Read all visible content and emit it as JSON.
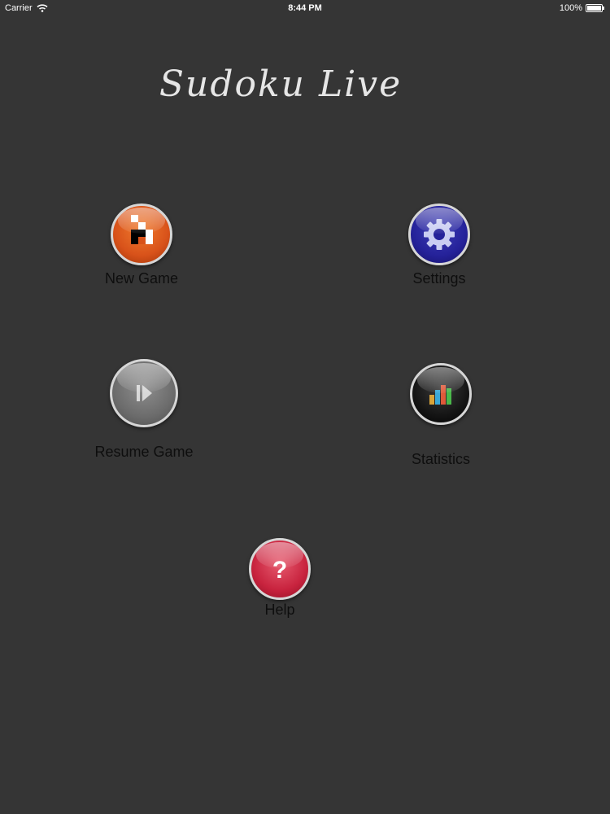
{
  "status_bar": {
    "carrier": "Carrier",
    "time": "8:44 PM",
    "battery": "100%"
  },
  "app": {
    "title": "Sudoku Live"
  },
  "menu": {
    "new_game": {
      "label": "New Game",
      "icon": "grid-blocks-icon",
      "color": "#d8521a"
    },
    "settings": {
      "label": "Settings",
      "icon": "gear-icon",
      "color": "#25229a"
    },
    "resume_game": {
      "label": "Resume Game",
      "icon": "play-pause-icon",
      "color": "#6c6c6c"
    },
    "statistics": {
      "label": "Statistics",
      "icon": "bar-chart-icon",
      "color": "#151515"
    },
    "help": {
      "label": "Help",
      "icon": "question-mark-icon",
      "color": "#c8233e"
    }
  }
}
